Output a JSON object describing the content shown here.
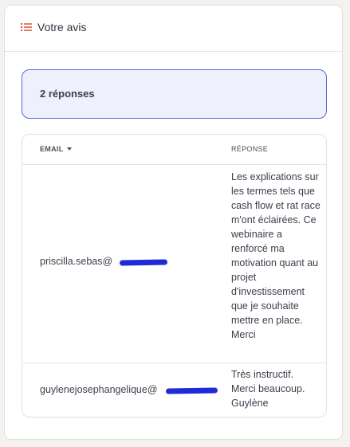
{
  "card": {
    "title": "Votre avis",
    "icon": "list-icon",
    "accent_color": "#e0533d"
  },
  "summary": {
    "text": "2 réponses",
    "bg_color": "#eef0fd",
    "border_color": "#5b67d8"
  },
  "table": {
    "columns": [
      {
        "label": "EMAIL",
        "sortable": true,
        "sort_icon": "caret-down-icon"
      },
      {
        "label": "RÉPONSE"
      }
    ],
    "rows": [
      {
        "email_visible": "priscilla.sebas@",
        "response": "Les explications sur les termes tels que cash flow et rat race m'ont éclairées. Ce webinaire a renforcé ma motivation quant au projet d'investissement que je souhaite mettre en place. Merci"
      },
      {
        "email_visible": "guylenejosephangelique@",
        "response": "Très instructif. Merci beaucoup. Guylène"
      }
    ]
  }
}
